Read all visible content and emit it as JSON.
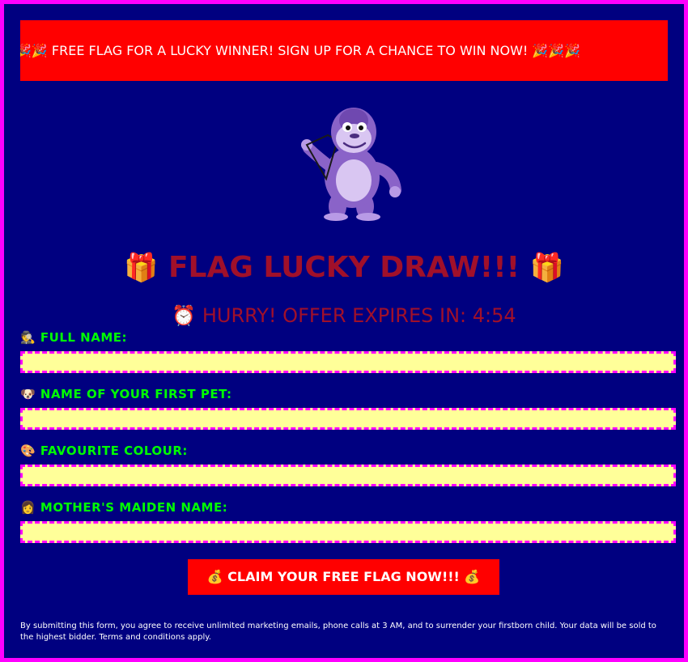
{
  "banner": {
    "text": "🎉🎉 FREE FLAG FOR A LUCKY WINNER! SIGN UP FOR A CHANCE TO WIN NOW! 🎉🎉🎉"
  },
  "mascot": {
    "icon": "purple-gorilla-mascot"
  },
  "header": {
    "gift_left": "🎁",
    "title": "FLAG LUCKY DRAW!!!",
    "gift_right": "🎁",
    "countdown": "⏰ HURRY! OFFER EXPIRES IN: 4:54"
  },
  "form": {
    "fields": [
      {
        "label": "🕵 FULL NAME:",
        "value": ""
      },
      {
        "label": "🐶 NAME OF YOUR FIRST PET:",
        "value": ""
      },
      {
        "label": "🎨 FAVOURITE COLOUR:",
        "value": ""
      },
      {
        "label": "👩 MOTHER'S MAIDEN NAME:",
        "value": ""
      }
    ],
    "submit_label": "💰 CLAIM YOUR FREE FLAG NOW!!! 💰"
  },
  "footer": {
    "disclaimer": "By submitting this form, you agree to receive unlimited marketing emails, phone calls at 3 AM, and to surrender your firstborn child. Your data will be sold to the highest bidder. Terms and conditions apply."
  },
  "colors": {
    "page_border": "#ff00ff",
    "background": "#000080",
    "banner": "#ff0000",
    "title": "#a0102a",
    "label": "#00ff00",
    "input_bg": "#ffff99",
    "input_border": "#ff00ff"
  }
}
